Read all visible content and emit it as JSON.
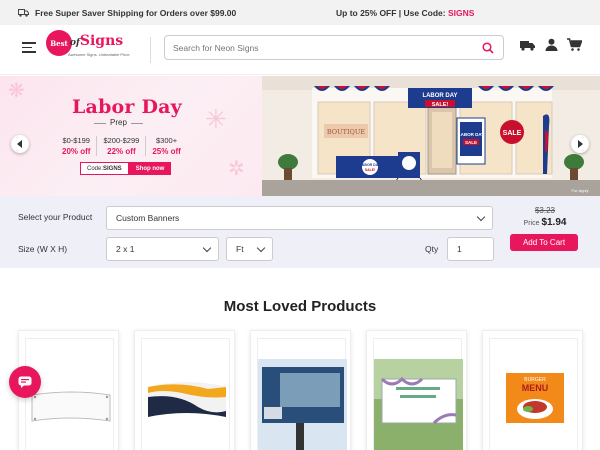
{
  "topbar": {
    "shipping_text": "Free Super Saver Shipping for Orders over $99.00",
    "promo_text": "Up to 25% OFF | Use Code: ",
    "promo_code": "SIGNS"
  },
  "header": {
    "logo_mark": "Best",
    "logo_word": "Signs",
    "logo_of": "of",
    "logo_tagline": "Awesome Signs. Unbeatable Price.",
    "search_placeholder": "Search for Neon Signs"
  },
  "banner": {
    "title": "Labor Day",
    "subtitle": "Prep",
    "tiers": [
      {
        "range": "$0-$199",
        "discount": "20% off"
      },
      {
        "range": "$200-$299",
        "discount": "22% off"
      },
      {
        "range": "$300+",
        "discount": "25% off"
      }
    ],
    "code_label": "Code: ",
    "code_value": "SIGNS",
    "shop_now": "Shop now",
    "store_signs": {
      "top_banner": "LABOR DAY SALE!",
      "boutique": "BOUTIQUE",
      "table": "LABOR DAY SALE!",
      "standee": "LABOR DAY SALE!",
      "round": "SALE",
      "small": "For Apply"
    }
  },
  "config": {
    "product_label": "Select your Product",
    "product_value": "Custom Banners",
    "size_label": "Size (W X H)",
    "size_value": "2 x 1",
    "unit_value": "Ft",
    "qty_label": "Qty",
    "qty_value": "1",
    "old_price": "$3.23",
    "price_label": "Price",
    "new_price": "$1.94",
    "cart_button": "Add To Cart"
  },
  "most_loved": {
    "title": "Most Loved Products",
    "card_texts": {
      "menu_label": "MENU",
      "menu_top": "BURGER"
    }
  },
  "colors": {
    "accent": "#e8175d",
    "config_bg": "#efeff8"
  }
}
